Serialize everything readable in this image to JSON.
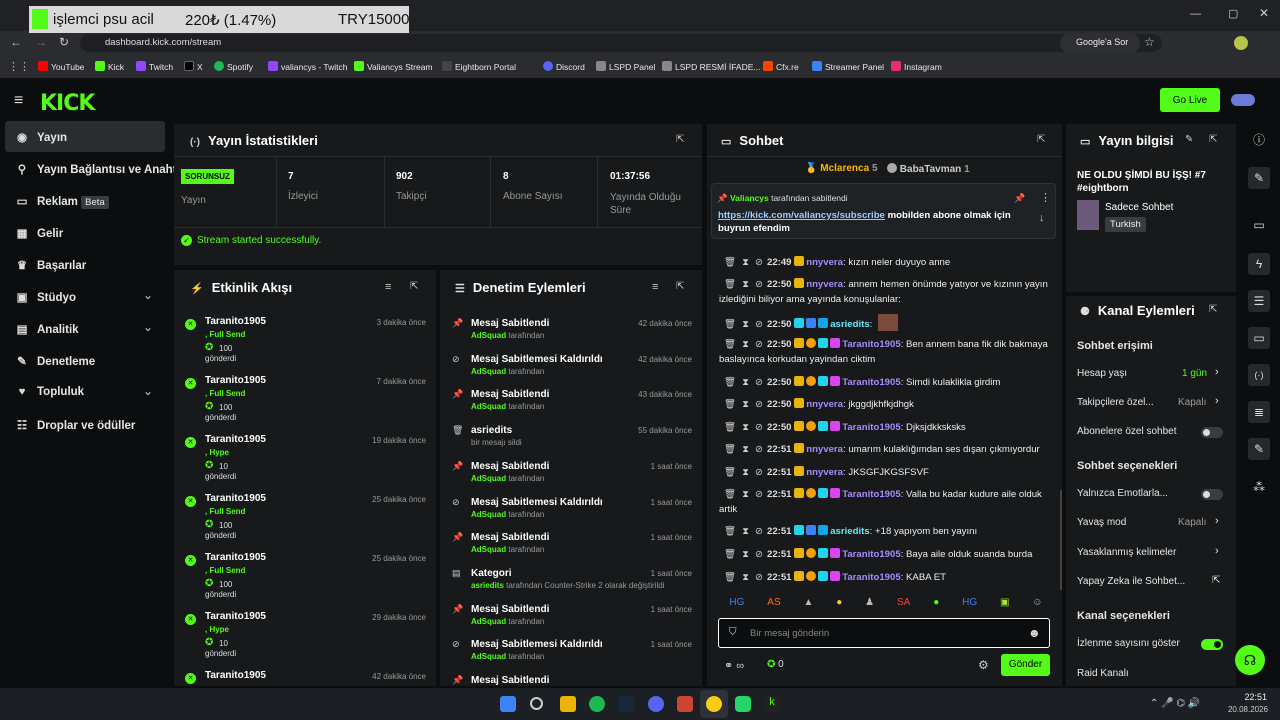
{
  "overlay": {
    "text": "işlemci psu acil",
    "amount": "220₺ (1.47%)",
    "goal": "TRY15000"
  },
  "browser": {
    "url": "dashboard.kick.com/stream",
    "google_btn": "Google'a Sor",
    "bookmarks": [
      "YouTube",
      "Kick",
      "Twitch",
      "X",
      "Spotify",
      "valiancys - Twitch",
      "Valiancys Stream",
      "Eightborn Portal",
      "Discord",
      "LSPD Panel",
      "LSPD  RESMİ İFADE...",
      "Cfx.re",
      "Streamer Panel",
      "Instagram"
    ]
  },
  "header": {
    "golive": "Go Live"
  },
  "sidebar": {
    "items": [
      "Yayın",
      "Yayın Bağlantısı ve Anahtar",
      "Reklam",
      "Gelir",
      "Başarılar",
      "Stüdyo",
      "Analitik",
      "Denetleme",
      "Topluluk",
      "Droplar ve ödüller"
    ],
    "beta": "Beta"
  },
  "stats": {
    "title": "Yayın İstatistikleri",
    "status": "SORUNSUZ",
    "status_label": "Yayın",
    "viewers": "7",
    "viewers_label": "İzleyici",
    "followers": "902",
    "followers_label": "Takipçi",
    "subs": "8",
    "subs_label": "Abone Sayısı",
    "uptime": "01:37:56",
    "uptime_label": "Yayında Olduğu Süre",
    "success": "Stream started successfully."
  },
  "activity": {
    "title": "Etkinlik Akışı",
    "items": [
      {
        "name": "Taranito1905",
        "tier": ", Full Send",
        "count": "100",
        "sent": "gönderdi",
        "time": "3 dakika önce"
      },
      {
        "name": "Taranito1905",
        "tier": ", Full Send",
        "count": "100",
        "sent": "gönderdi",
        "time": "7 dakika önce"
      },
      {
        "name": "Taranito1905",
        "tier": ", Hype",
        "count": "10",
        "sent": "gönderdi",
        "time": "19 dakika önce"
      },
      {
        "name": "Taranito1905",
        "tier": ", Full Send",
        "count": "100",
        "sent": "gönderdi",
        "time": "25 dakika önce"
      },
      {
        "name": "Taranito1905",
        "tier": ", Full Send",
        "count": "100",
        "sent": "gönderdi",
        "time": "25 dakika önce"
      },
      {
        "name": "Taranito1905",
        "tier": ", Hype",
        "count": "10",
        "sent": "gönderdi",
        "time": "29 dakika önce"
      },
      {
        "name": "Taranito1905",
        "tier": "",
        "count": "",
        "sent": "",
        "time": "42 dakika önce"
      }
    ]
  },
  "moderation": {
    "title": "Denetim Eylemleri",
    "items": [
      {
        "title": "Mesaj Sabitlendi",
        "by": "AdSquad",
        "by_suffix": "tarafından",
        "time": "42 dakika önce"
      },
      {
        "title": "Mesaj Sabitlemesi Kaldırıldı",
        "by": "AdSquad",
        "by_suffix": "tarafından",
        "time": "42 dakika önce"
      },
      {
        "title": "Mesaj Sabitlendi",
        "by": "AdSquad",
        "by_suffix": "tarafından",
        "time": "43 dakika önce"
      },
      {
        "title": "asriedits",
        "by": "",
        "by_suffix": "bir mesajı sildi",
        "time": "55 dakika önce"
      },
      {
        "title": "Mesaj Sabitlendi",
        "by": "AdSquad",
        "by_suffix": "tarafından",
        "time": "1 saat önce"
      },
      {
        "title": "Mesaj Sabitlemesi Kaldırıldı",
        "by": "AdSquad",
        "by_suffix": "tarafından",
        "time": "1 saat önce"
      },
      {
        "title": "Mesaj Sabitlendi",
        "by": "AdSquad",
        "by_suffix": "tarafından",
        "time": "1 saat önce"
      },
      {
        "title": "Kategori",
        "by": "asriedits",
        "by_suffix": "tarafından Counter-Strike 2 olarak değiştirildi",
        "time": "1 saat önce"
      },
      {
        "title": "Mesaj Sabitlendi",
        "by": "AdSquad",
        "by_suffix": "tarafından",
        "time": "1 saat önce"
      },
      {
        "title": "Mesaj Sabitlemesi Kaldırıldı",
        "by": "AdSquad",
        "by_suffix": "tarafından",
        "time": "1 saat önce"
      },
      {
        "title": "Mesaj Sabitlendi",
        "by": "",
        "by_suffix": "",
        "time": ""
      }
    ]
  },
  "chat": {
    "title": "Sohbet",
    "top1": "Mclarenca",
    "top1n": "5",
    "top2": "BabaTavman",
    "top2n": "1",
    "pinned_by": "Valiancys",
    "pinned_suffix": "tarafından sabitlendi",
    "pinned_link": "https://kick.com/valiancys/subscribe",
    "pinned_text": " mobilden abone olmak için buyrun efendim",
    "lines": [
      {
        "time": "22:49",
        "user": "nnyvera",
        "cls": "u-purple",
        "msg": "kızın neler duyuyo anne"
      },
      {
        "time": "22:50",
        "user": "nnyvera",
        "cls": "u-purple",
        "msg": "annem hemen önümde yatıyor ve kızının yayın izlediğini biliyor ama yayında konuşulanlar:"
      },
      {
        "time": "22:50",
        "user": "asriedits",
        "cls": "u-cyan",
        "msg": ""
      },
      {
        "time": "22:50",
        "user": "Taranito1905",
        "cls": "u-purple",
        "msg": "Ben annem bana fik dik bakmaya baslayınca korkudan yayindan ciktim"
      },
      {
        "time": "22:50",
        "user": "Taranito1905",
        "cls": "u-purple",
        "msg": "Simdi kulaklikla girdim"
      },
      {
        "time": "22:50",
        "user": "nnyvera",
        "cls": "u-purple",
        "msg": "jkggdjkhfkjdhgk"
      },
      {
        "time": "22:50",
        "user": "Taranito1905",
        "cls": "u-purple",
        "msg": "Djksjdkksksks"
      },
      {
        "time": "22:51",
        "user": "nnyvera",
        "cls": "u-purple",
        "msg": "umarım kulaklığımdan ses dışarı çıkmıyordur"
      },
      {
        "time": "22:51",
        "user": "nnyvera",
        "cls": "u-purple",
        "msg": "JKSGFJKGSFSVF"
      },
      {
        "time": "22:51",
        "user": "Taranito1905",
        "cls": "u-purple",
        "msg": "Valla bu kadar kudure aile olduk artik"
      },
      {
        "time": "22:51",
        "user": "asriedits",
        "cls": "u-cyan",
        "msg": "+18 yapıyom ben yayını"
      },
      {
        "time": "22:51",
        "user": "Taranito1905",
        "cls": "u-purple",
        "msg": "Baya aile olduk suanda burda"
      },
      {
        "time": "22:51",
        "user": "Taranito1905",
        "cls": "u-purple",
        "msg": "KABA ET"
      }
    ],
    "placeholder": "Bir mesaj gönderin",
    "count": "0",
    "send": "Gönder"
  },
  "info": {
    "title": "Yayın bilgisi",
    "stream_title": "NE OLDU ŞİMDİ BU İŞŞ! #7 #eightborn",
    "category": "Sadece Sohbet",
    "lang": "Turkish"
  },
  "channel": {
    "title": "Kanal Eylemleri",
    "chat_access": "Sohbet erişimi",
    "acc_age": "Hesap yaşı",
    "acc_age_val": "1 gün",
    "followers_only": "Takipçilere özel...",
    "followers_only_val": "Kapalı",
    "subs_only": "Abonelere özel sohbet",
    "chat_options": "Sohbet seçenekleri",
    "emote_only": "Yalnızca Emotlarla...",
    "slow": "Yavaş mod",
    "slow_val": "Kapalı",
    "banned": "Yasaklanmış kelimeler",
    "ai": "Yapay Zeka ile Sohbet...",
    "channel_options": "Kanal seçenekleri",
    "show_views": "İzlenme sayısını göster",
    "raid": "Raid Kanalı"
  },
  "taskbar": {
    "time": "22:51",
    "date": "20.08.2026"
  },
  "colors": {
    "accent": "#53fc18",
    "panel": "#17191b",
    "bg": "#0b0d0e"
  }
}
